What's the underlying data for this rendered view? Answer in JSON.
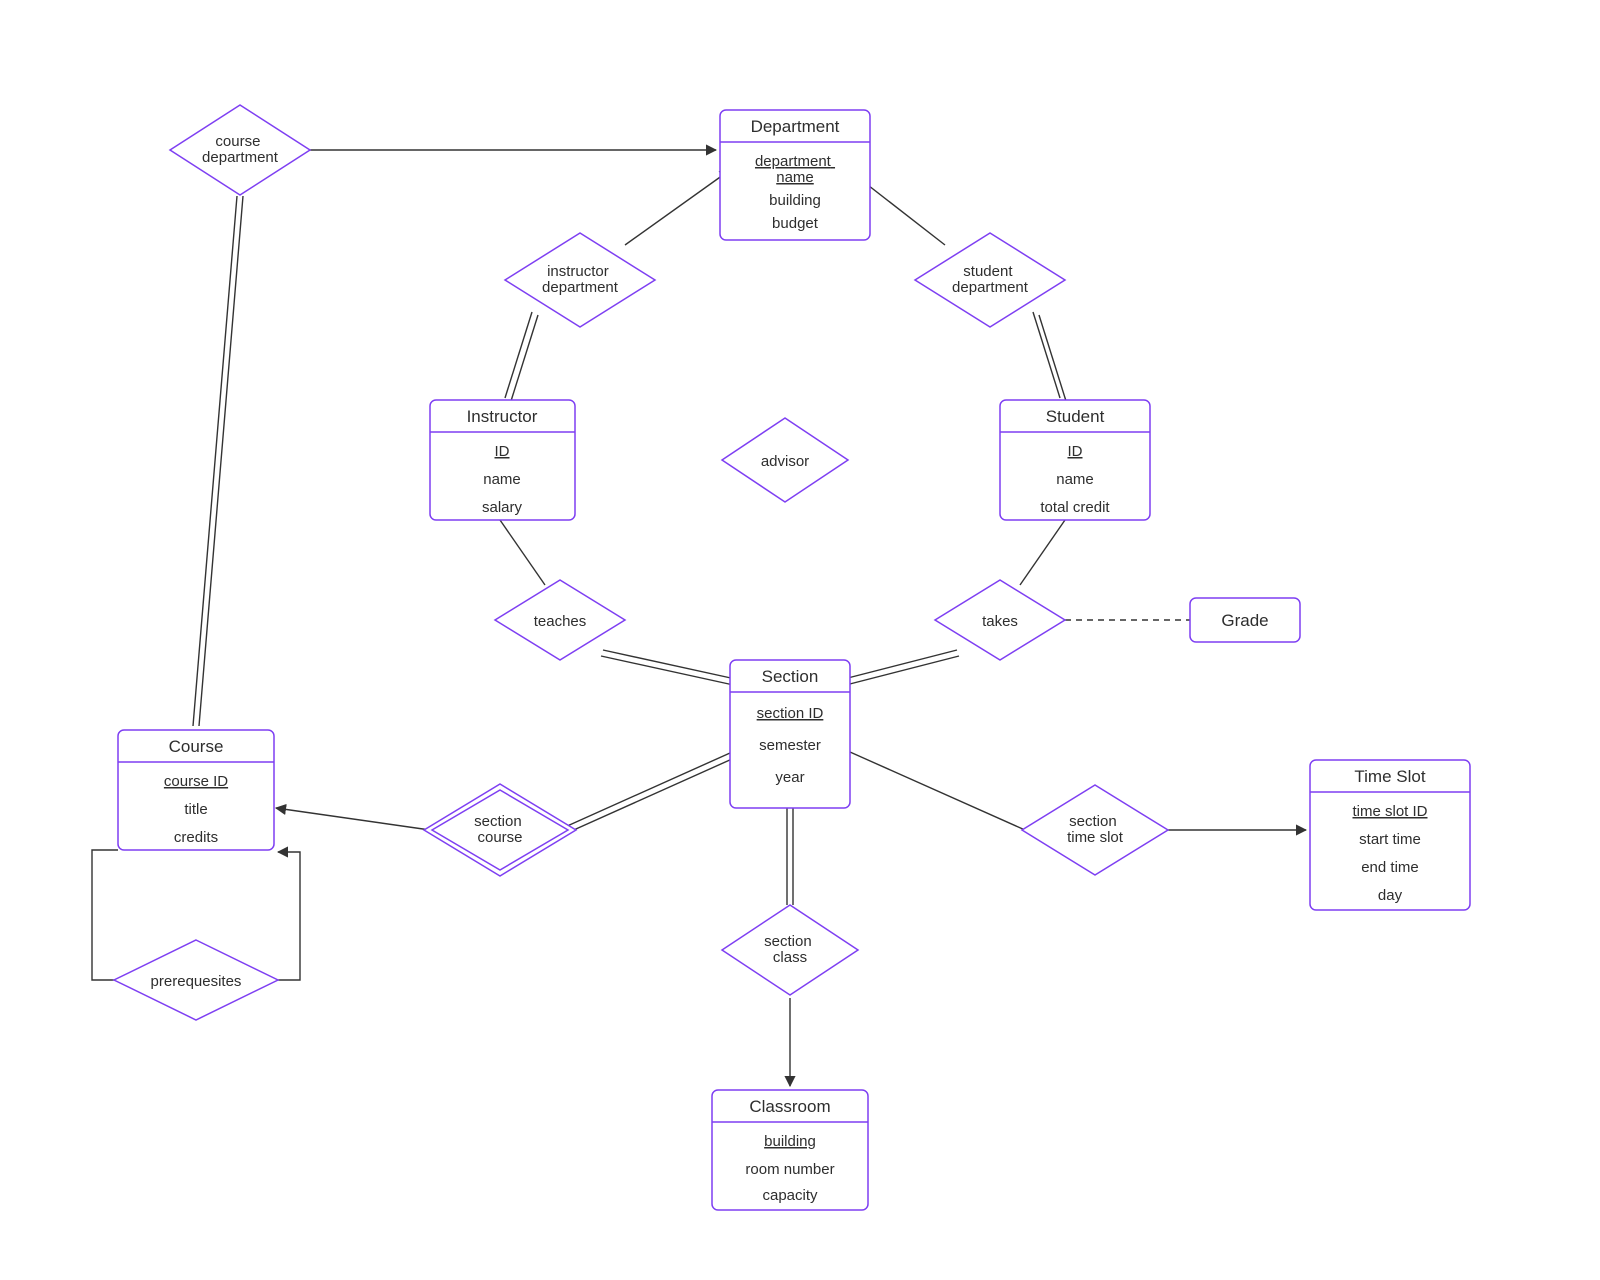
{
  "entities": {
    "department": {
      "title": "Department",
      "attrs": [
        "department name",
        "building",
        "budget"
      ],
      "keyIndex": 0
    },
    "instructor": {
      "title": "Instructor",
      "attrs": [
        "ID",
        "name",
        "salary"
      ],
      "keyIndex": 0
    },
    "student": {
      "title": "Student",
      "attrs": [
        "ID",
        "name",
        "total credit"
      ],
      "keyIndex": 0
    },
    "section": {
      "title": "Section",
      "attrs": [
        "section ID",
        "semester",
        "year"
      ],
      "keyIndex": 0
    },
    "course": {
      "title": "Course",
      "attrs": [
        "course ID",
        "title",
        "credits"
      ],
      "keyIndex": 0
    },
    "time_slot": {
      "title": "Time Slot",
      "attrs": [
        "time slot ID",
        "start time",
        "end time",
        "day"
      ],
      "keyIndex": 0
    },
    "classroom": {
      "title": "Classroom",
      "attrs": [
        "building",
        "room number",
        "capacity"
      ],
      "keyIndex": 0
    },
    "grade": {
      "title": "Grade"
    }
  },
  "relationships": {
    "course_department": "course department",
    "instructor_department": "instructor department",
    "student_department": "student department",
    "advisor": "advisor",
    "teaches": "teaches",
    "takes": "takes",
    "section_course": "section course",
    "section_time_slot": "section time slot",
    "section_class": "section class",
    "prerequisites": "prerequesites"
  },
  "colors": {
    "shape_stroke": "#7e3ff2",
    "edge": "#333333",
    "bg": "#ffffff",
    "text": "#2e2e2e"
  }
}
